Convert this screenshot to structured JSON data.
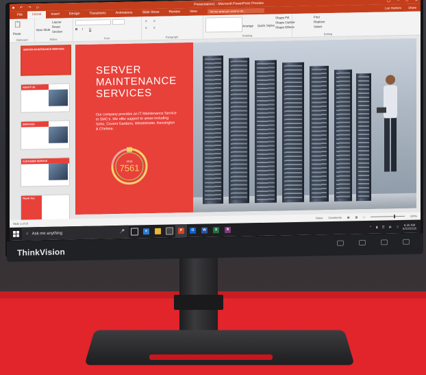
{
  "monitor": {
    "brand": "ThinkVision"
  },
  "app": {
    "window_title": "Presentation1 - Microsoft PowerPoint Preview",
    "tabs": [
      "File",
      "Home",
      "Insert",
      "Design",
      "Transitions",
      "Animations",
      "Slide Show",
      "Review",
      "View"
    ],
    "active_tab": "Home",
    "tell_me": "Tell me what you want to do...",
    "user": "Lori Holmes",
    "share": "Share",
    "ribbon": {
      "clipboard": {
        "paste": "Paste",
        "label": "Clipboard"
      },
      "slides": {
        "new_slide": "New Slide",
        "layout": "Layout",
        "reset": "Reset",
        "section": "Section",
        "label": "Slides"
      },
      "font": {
        "label": "Font"
      },
      "paragraph": {
        "label": "Paragraph"
      },
      "drawing": {
        "arrange": "Arrange",
        "quick_styles": "Quick Styles",
        "shape_fill": "Shape Fill",
        "shape_outline": "Shape Outline",
        "shape_effects": "Shape Effects",
        "label": "Drawing"
      },
      "editing": {
        "find": "Find",
        "replace": "Replace",
        "select": "Select",
        "label": "Editing"
      }
    },
    "thumbnails": [
      {
        "num": "1",
        "header": "SERVER MAINTENANCE SERVICES"
      },
      {
        "num": "2",
        "header": "ABOUT US"
      },
      {
        "num": "3",
        "header": "SERVICES"
      },
      {
        "num": "4",
        "header": "CUSTOMER SERVICE"
      },
      {
        "num": "5",
        "header": "Thank You"
      }
    ],
    "status": {
      "slide_count": "Slide 1 of 10",
      "notes": "Notes",
      "comments": "Comments",
      "zoom": "100%"
    }
  },
  "slide": {
    "title_line1": "SERVER",
    "title_line2": "MAINTENANCE",
    "title_line3": "SERVICES",
    "body": "Our company provides an IT Maintenance Service to SMC's. We offer support to areas including Soho, Covent Gardens, Westminster, Kensington & Chelsea.",
    "stat_year": "2016",
    "stat_value": "7561"
  },
  "taskbar": {
    "search_placeholder": "Ask me anything",
    "time": "6:30 AM",
    "date": "6/10/2016"
  },
  "colors": {
    "ppt_accent": "#c43e1c",
    "slide_red": "#e8413a",
    "backdrop_red": "#e2242b"
  }
}
